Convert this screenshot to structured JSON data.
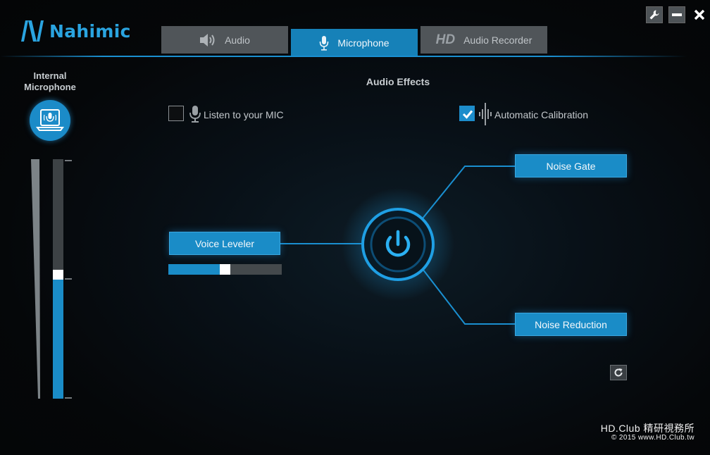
{
  "app": {
    "brand": "Nahimic"
  },
  "tabs": [
    {
      "label": "Audio",
      "icon": "speaker-icon",
      "active": false
    },
    {
      "label": "Microphone",
      "icon": "microphone-icon",
      "active": true
    },
    {
      "label": "Audio Recorder",
      "prefix": "HD",
      "icon": "hd-icon",
      "active": false
    }
  ],
  "window_controls": [
    "settings-wrench-icon",
    "minimize-icon",
    "close-icon"
  ],
  "device": {
    "title_line1": "Internal",
    "title_line2": "Microphone",
    "icon": "laptop-microphone-icon",
    "level": 0.5
  },
  "effects": {
    "title": "Audio Effects",
    "listen": {
      "label": "Listen to your MIC",
      "checked": false
    },
    "calibration": {
      "label": "Automatic Calibration",
      "checked": true
    },
    "voice_leveler": {
      "label": "Voice Leveler",
      "level": 0.5
    },
    "noise_gate": {
      "label": "Noise Gate"
    },
    "noise_reduction": {
      "label": "Noise Reduction"
    },
    "power": {
      "icon": "power-icon",
      "on": true
    }
  },
  "watermark": {
    "line1": "HD.Club 精研視務所",
    "line2": "© 2015  www.HD.Club.tw"
  },
  "colors": {
    "accent": "#1a8cc7",
    "glow": "#2aa4e0",
    "background": "#050709"
  }
}
